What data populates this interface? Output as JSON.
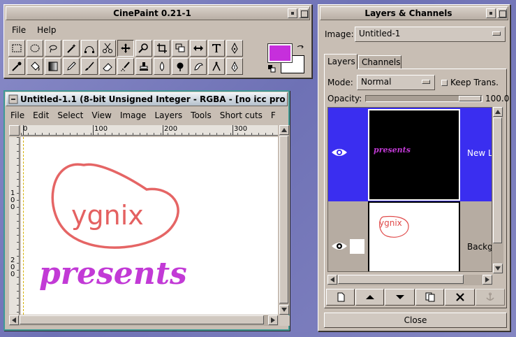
{
  "toolbox": {
    "title": "CinePaint 0.21-1",
    "menu": [
      "File",
      "Help"
    ],
    "tools": [
      "rect-select",
      "ellipse-select",
      "free-select",
      "fuzzy-select",
      "bezier-select",
      "scissors",
      "move",
      "magnify",
      "crop",
      "transform",
      "flip",
      "text",
      "color-picker",
      "eyedropper",
      "bucket-fill",
      "gradient",
      "pencil",
      "paintbrush",
      "eraser",
      "airbrush",
      "clone",
      "convolve",
      "dodge-burn",
      "smudge",
      "measure",
      "ink"
    ],
    "fg_color": "#c62fdc",
    "bg_color": "#ffffff"
  },
  "image_window": {
    "title": "Untitled-1.1 (8-bit Unsigned Integer - RGBA - [no icc pro",
    "menu": [
      "File",
      "Edit",
      "Select",
      "View",
      "Image",
      "Layers",
      "Tools",
      "Short cuts",
      "F"
    ],
    "ruler_h": [
      "0",
      "100",
      "200",
      "300"
    ],
    "ruler_v": [
      "1\n0\n0",
      "2\n0\n0"
    ],
    "logo_text": "ygnix",
    "presents_text": "presents",
    "accent": "#c23ad6"
  },
  "layers_dialog": {
    "title": "Layers & Channels",
    "image_label": "Image:",
    "image_value": "Untitled-1",
    "tabs": [
      "Layers",
      "Channels"
    ],
    "mode_label": "Mode:",
    "mode_value": "Normal",
    "keep_trans_label": "Keep Trans.",
    "opacity_label": "Opacity:",
    "opacity_value": "100.0",
    "layers": [
      {
        "name": "New L",
        "thumb_text": "presents",
        "selected": true
      },
      {
        "name": "Backg",
        "thumb_text": "ygnix",
        "selected": false
      }
    ],
    "buttons": [
      "new-layer",
      "raise-layer",
      "lower-layer",
      "duplicate-layer",
      "delete-layer",
      "anchor-layer"
    ],
    "close_label": "Close",
    "selection_color": "#3a2ef0"
  }
}
